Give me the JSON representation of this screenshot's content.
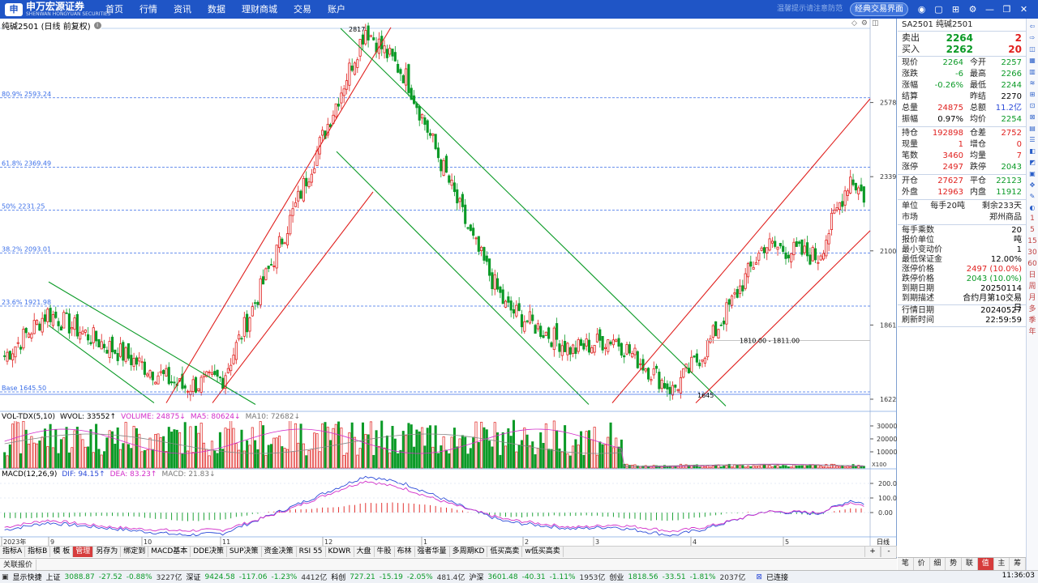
{
  "brand": {
    "name": "申万宏源证券",
    "sub": "SHENWAN HONGYUAN SECURITIES"
  },
  "nav": [
    "首页",
    "行情",
    "资讯",
    "数据",
    "理财商城",
    "交易",
    "账户"
  ],
  "topbar": {
    "muted_text": "温馨提示请注意防范",
    "classic_btn": "经典交易界面"
  },
  "chart": {
    "title": "纯碱2501 (日线 前复权)",
    "fib": [
      {
        "label": "80.9% 2593.24",
        "price": 2593.24
      },
      {
        "label": "61.8% 2369.49",
        "price": 2369.49
      },
      {
        "label": "50% 2231.25",
        "price": 2231.25
      },
      {
        "label": "38.2% 2093.01",
        "price": 2093.01
      },
      {
        "label": "23.6% 1921.98",
        "price": 1921.98
      },
      {
        "label": "Base 1645.50",
        "price": 1645.5
      }
    ],
    "y_ticks": [
      "2578",
      "2339",
      "2100",
      "1861",
      "1622"
    ],
    "y_tick_vals": [
      2578,
      2339,
      2100,
      1861,
      1622
    ],
    "high_label": "2817",
    "low_label": "1645",
    "box_label": "1810.00 - 1811.00",
    "x_ticks": [
      "2023年",
      "9",
      "10",
      "11",
      "12",
      "1",
      "2",
      "3",
      "4",
      "5"
    ],
    "vol_legend": {
      "a": "VOL-TDX(5,10)",
      "b": "WVOL: 33552↑",
      "c": "VOLUME: 24875↓",
      "d": "MA5: 80624↓",
      "e": "MA10: 72682↓"
    },
    "vol_ticks": [
      "30000",
      "20000",
      "10000"
    ],
    "vol_unit": "X100",
    "macd_legend": {
      "a": "MACD(12,26,9)",
      "b": "DIF: 94.15↑",
      "c": "DEA: 83.23↑",
      "d": "MACD: 21.83↓"
    },
    "macd_ticks": [
      "200.0",
      "100.0",
      "0.00"
    ],
    "period": "日线"
  },
  "tabs": [
    "指标A",
    "指标B",
    "模 板",
    "管理",
    "另存为",
    "绑定到",
    "MACD基本",
    "DDE决策",
    "SUP决策",
    "资金决策",
    "RSI 55",
    "KDWR",
    "大盘",
    "牛股",
    "布林",
    "强者华量",
    "多周期KD",
    "低买高卖",
    "w低买高卖"
  ],
  "tab_plus": "+",
  "tab_minus": "-",
  "relbar": "关联报价",
  "panel": {
    "title": "SA2501 纯碱2501",
    "sell": {
      "l": "卖出",
      "p": "2264",
      "q": "2"
    },
    "buy": {
      "l": "买入",
      "p": "2262",
      "q": "20"
    },
    "rows1": [
      [
        "现价",
        "2264",
        "今开",
        "2257"
      ],
      [
        "涨跌",
        "-6",
        "最高",
        "2266"
      ],
      [
        "涨幅",
        "-0.26%",
        "最低",
        "2244"
      ],
      [
        "结算",
        "",
        "昨结",
        "2270"
      ],
      [
        "总量",
        "24875",
        "总额",
        "11.2亿"
      ],
      [
        "振幅",
        "0.97%",
        "均价",
        "2254"
      ]
    ],
    "rows2": [
      [
        "持仓",
        "192898",
        "仓差",
        "2752"
      ],
      [
        "现量",
        "1",
        "增仓",
        "0"
      ],
      [
        "笔数",
        "3460",
        "均量",
        "7"
      ],
      [
        "涨停",
        "2497",
        "跌停",
        "2043"
      ]
    ],
    "rows3": [
      [
        "开仓",
        "27627",
        "平仓",
        "22123"
      ],
      [
        "外盘",
        "12963",
        "内盘",
        "11912"
      ]
    ],
    "unit": {
      "l": "单位",
      "a": "每手20吨",
      "b": "剩余233天"
    },
    "market": {
      "l": "市场",
      "v": "郑州商品"
    },
    "contract": [
      [
        "每手乘数",
        "20"
      ],
      [
        "报价单位",
        "吨"
      ],
      [
        "最小变动价",
        "1"
      ],
      [
        "最低保证金",
        "12.00%"
      ],
      [
        "涨停价格",
        "2497 (10.0%)"
      ],
      [
        "跌停价格",
        "2043 (10.0%)"
      ],
      [
        "到期日期",
        "20250114"
      ],
      [
        "到期描述",
        "合约月第10交易日"
      ]
    ],
    "dates": [
      [
        "行情日期",
        "20240527"
      ],
      [
        "刷新时间",
        "22:59:59"
      ]
    ],
    "tabs": [
      "笔",
      "价",
      "细",
      "势",
      "联",
      "值",
      "主",
      "筹"
    ]
  },
  "rstrip": [
    "⇦",
    "⇨",
    "◫",
    "▦",
    "▥",
    "≋",
    "⊞",
    "⊡",
    "⊠",
    "▤",
    "☰",
    "◧",
    "◩",
    "▣",
    "✥",
    "✎",
    "◐",
    "1",
    "5",
    "15",
    "30",
    "60",
    "日",
    "周",
    "月",
    "多",
    "季",
    "年"
  ],
  "status": {
    "btn": "显示快捷",
    "items": [
      [
        "上证",
        "3088.87",
        "-27.52",
        "-0.88%",
        "3227亿"
      ],
      [
        "深证",
        "9424.58",
        "-117.06",
        "-1.23%",
        "4412亿"
      ],
      [
        "科创",
        "727.21",
        "-15.19",
        "-2.05%",
        "481.4亿"
      ],
      [
        "沪深",
        "3601.48",
        "-40.31",
        "-1.11%",
        "1953亿"
      ],
      [
        "创业",
        "1818.56",
        "-33.51",
        "-1.81%",
        "2037亿"
      ]
    ],
    "conn": "已连接",
    "clock": "11:36:03"
  },
  "colors": {
    "up": "#e0201e",
    "down": "#0a9a26",
    "accent": "#1f55c6",
    "fib": "#3a6ee8"
  }
}
